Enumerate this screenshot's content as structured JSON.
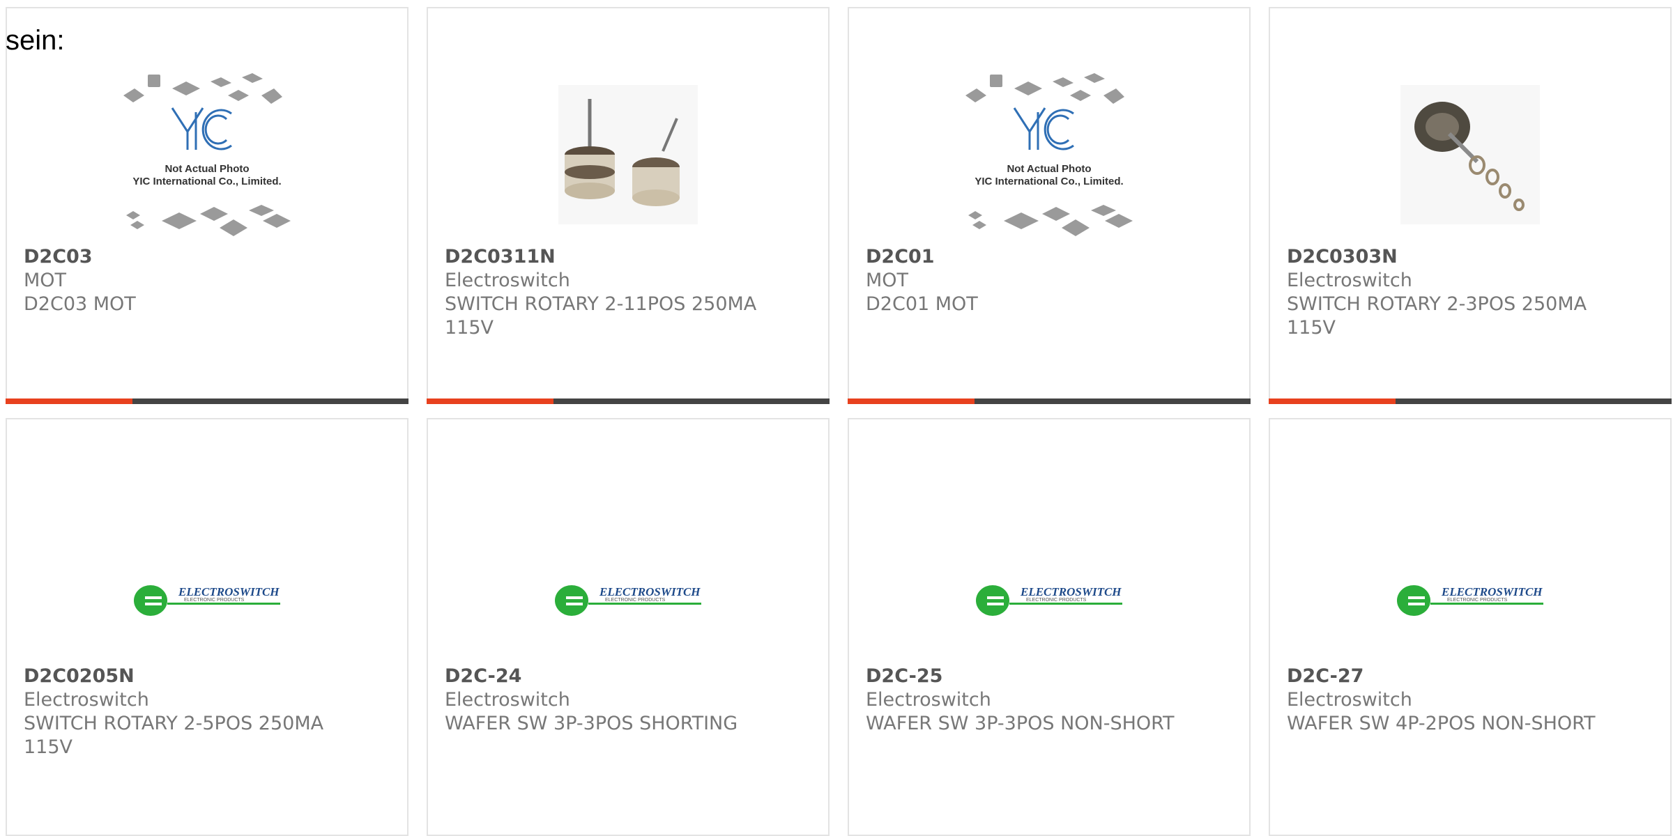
{
  "page": {
    "lead_text": "sein:"
  },
  "colors": {
    "accent": "#e8411e",
    "bar": "#444444",
    "electroswitch_green": "#2bae3a"
  },
  "products": [
    {
      "part": "D2C03",
      "maker": "MOT",
      "desc": "D2C03 MOT",
      "image": "yic-placeholder",
      "ph1": "Not Actual Photo",
      "ph2": "YIC International Co., Limited."
    },
    {
      "part": "D2C0311N",
      "maker": "Electroswitch",
      "desc": "SWITCH ROTARY 2-11POS 250MA 115V",
      "image": "rotary-switch-photo"
    },
    {
      "part": "D2C01",
      "maker": "MOT",
      "desc": "D2C01 MOT",
      "image": "yic-placeholder",
      "ph1": "Not Actual Photo",
      "ph2": "YIC International Co., Limited."
    },
    {
      "part": "D2C0303N",
      "maker": "Electroswitch",
      "desc": "SWITCH ROTARY 2-3POS 250MA 115V",
      "image": "rotary-switch-kit-photo"
    },
    {
      "part": "D2C0205N",
      "maker": "Electroswitch",
      "desc": "SWITCH ROTARY 2-5POS 250MA 115V",
      "image": "electroswitch-logo",
      "logo1": "ELECTROSWITCH",
      "logo2": "ELECTRONIC PRODUCTS"
    },
    {
      "part": "D2C-24",
      "maker": "Electroswitch",
      "desc": "WAFER SW 3P-3POS SHORTING",
      "image": "electroswitch-logo",
      "logo1": "ELECTROSWITCH",
      "logo2": "ELECTRONIC PRODUCTS"
    },
    {
      "part": "D2C-25",
      "maker": "Electroswitch",
      "desc": "WAFER SW 3P-3POS NON-SHORT",
      "image": "electroswitch-logo",
      "logo1": "ELECTROSWITCH",
      "logo2": "ELECTRONIC PRODUCTS"
    },
    {
      "part": "D2C-27",
      "maker": "Electroswitch",
      "desc": "WAFER SW 4P-2POS NON-SHORT",
      "image": "electroswitch-logo",
      "logo1": "ELECTROSWITCH",
      "logo2": "ELECTRONIC PRODUCTS"
    }
  ]
}
